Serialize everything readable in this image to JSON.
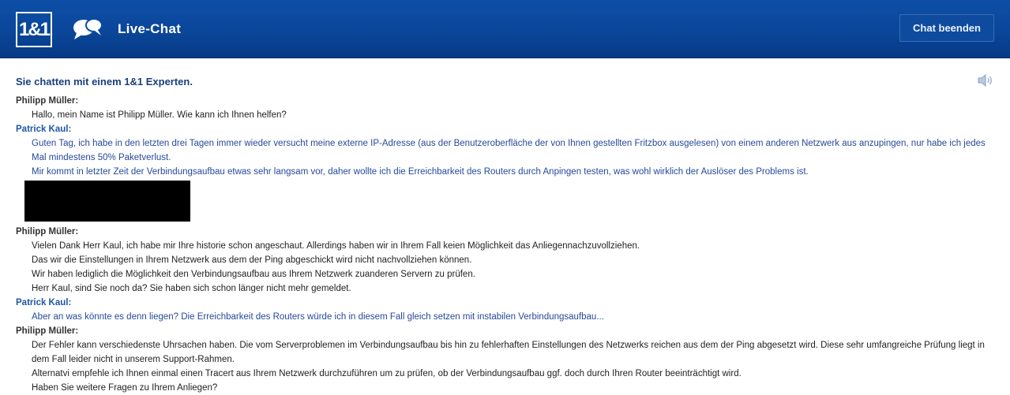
{
  "header": {
    "logo_text": "1&1",
    "title": "Live-Chat",
    "end_button_label": "Chat beenden"
  },
  "chat": {
    "subheading": "Sie chatten mit einem 1&1 Experten.",
    "blocks": [
      {
        "sender": "Philipp Müller:",
        "role": "agent",
        "lines": [
          "Hallo, mein Name ist Philipp Müller. Wie kann ich Ihnen helfen?"
        ]
      },
      {
        "sender": "Patrick Kaul:",
        "role": "customer",
        "lines": [
          "Guten Tag, ich habe in den letzten drei Tagen immer wieder versucht meine externe IP-Adresse (aus der Benutzeroberfläche der von Ihnen gestellten Fritzbox ausgelesen) von einem anderen Netzwerk aus anzupingen, nur habe ich jedes Mal mindestens 50% Paketverlust.",
          "Mir kommt in letzter Zeit der Verbindungsaufbau etwas sehr langsam vor, daher wollte ich die Erreichbarkeit des Routers durch Anpingen testen, was wohl wirklich der Auslöser des Problems ist."
        ]
      },
      {
        "sender": "Philipp Müller:",
        "role": "agent",
        "lines": [
          "Vielen Dank Herr Kaul, ich habe mir Ihre historie schon angeschaut. Allerdings haben wir in Ihrem Fall keien Möglichkeit das Anliegennachzuvollziehen.",
          "Das wir die Einstellungen in Ihrem Netzwerk aus dem der Ping abgeschickt wird nicht nachvollziehen können.",
          "Wir haben lediglich die Möglichkeit den Verbindungsaufbau aus Ihrem Netzwerk zuanderen Servern zu prüfen.",
          "Herr Kaul, sind Sie noch da? Sie haben sich schon länger nicht mehr gemeldet."
        ]
      },
      {
        "sender": "Patrick Kaul:",
        "role": "customer",
        "lines": [
          "Aber an was könnte es denn liegen? Die Erreichbarkeit des Routers würde ich in diesem Fall gleich setzen mit instabilen Verbindungsaufbau..."
        ]
      },
      {
        "sender": "Philipp Müller:",
        "role": "agent",
        "lines": [
          "Der Fehler kann verschiedenste Uhrsachen haben. Die vom Serverproblemen im Verbindungsaufbau bis hin zu fehlerhaften Einstellungen des Netzwerks reichen aus dem der Ping abgesetzt wird. Diese sehr umfangreiche Prüfung liegt in dem Fall leider nicht in unserem Support-Rahmen.",
          "Alternatvi empfehle ich Ihnen einmal einen Tracert aus Ihrem Netzwerk durchzuführen um zu prüfen, ob der Verbindungsaufbau ggf. doch durch Ihren Router beeinträchtigt wird.",
          "Haben Sie weitere Fragen zu Ihrem Anliegen?"
        ]
      }
    ]
  },
  "icons": {
    "chat": "chat-bubbles-icon",
    "speaker": "speaker-icon"
  },
  "colors": {
    "header_blue": "#0a469a",
    "subheading_blue": "#1a3f7e",
    "customer_text": "#27499a",
    "agent_text": "#222222"
  }
}
